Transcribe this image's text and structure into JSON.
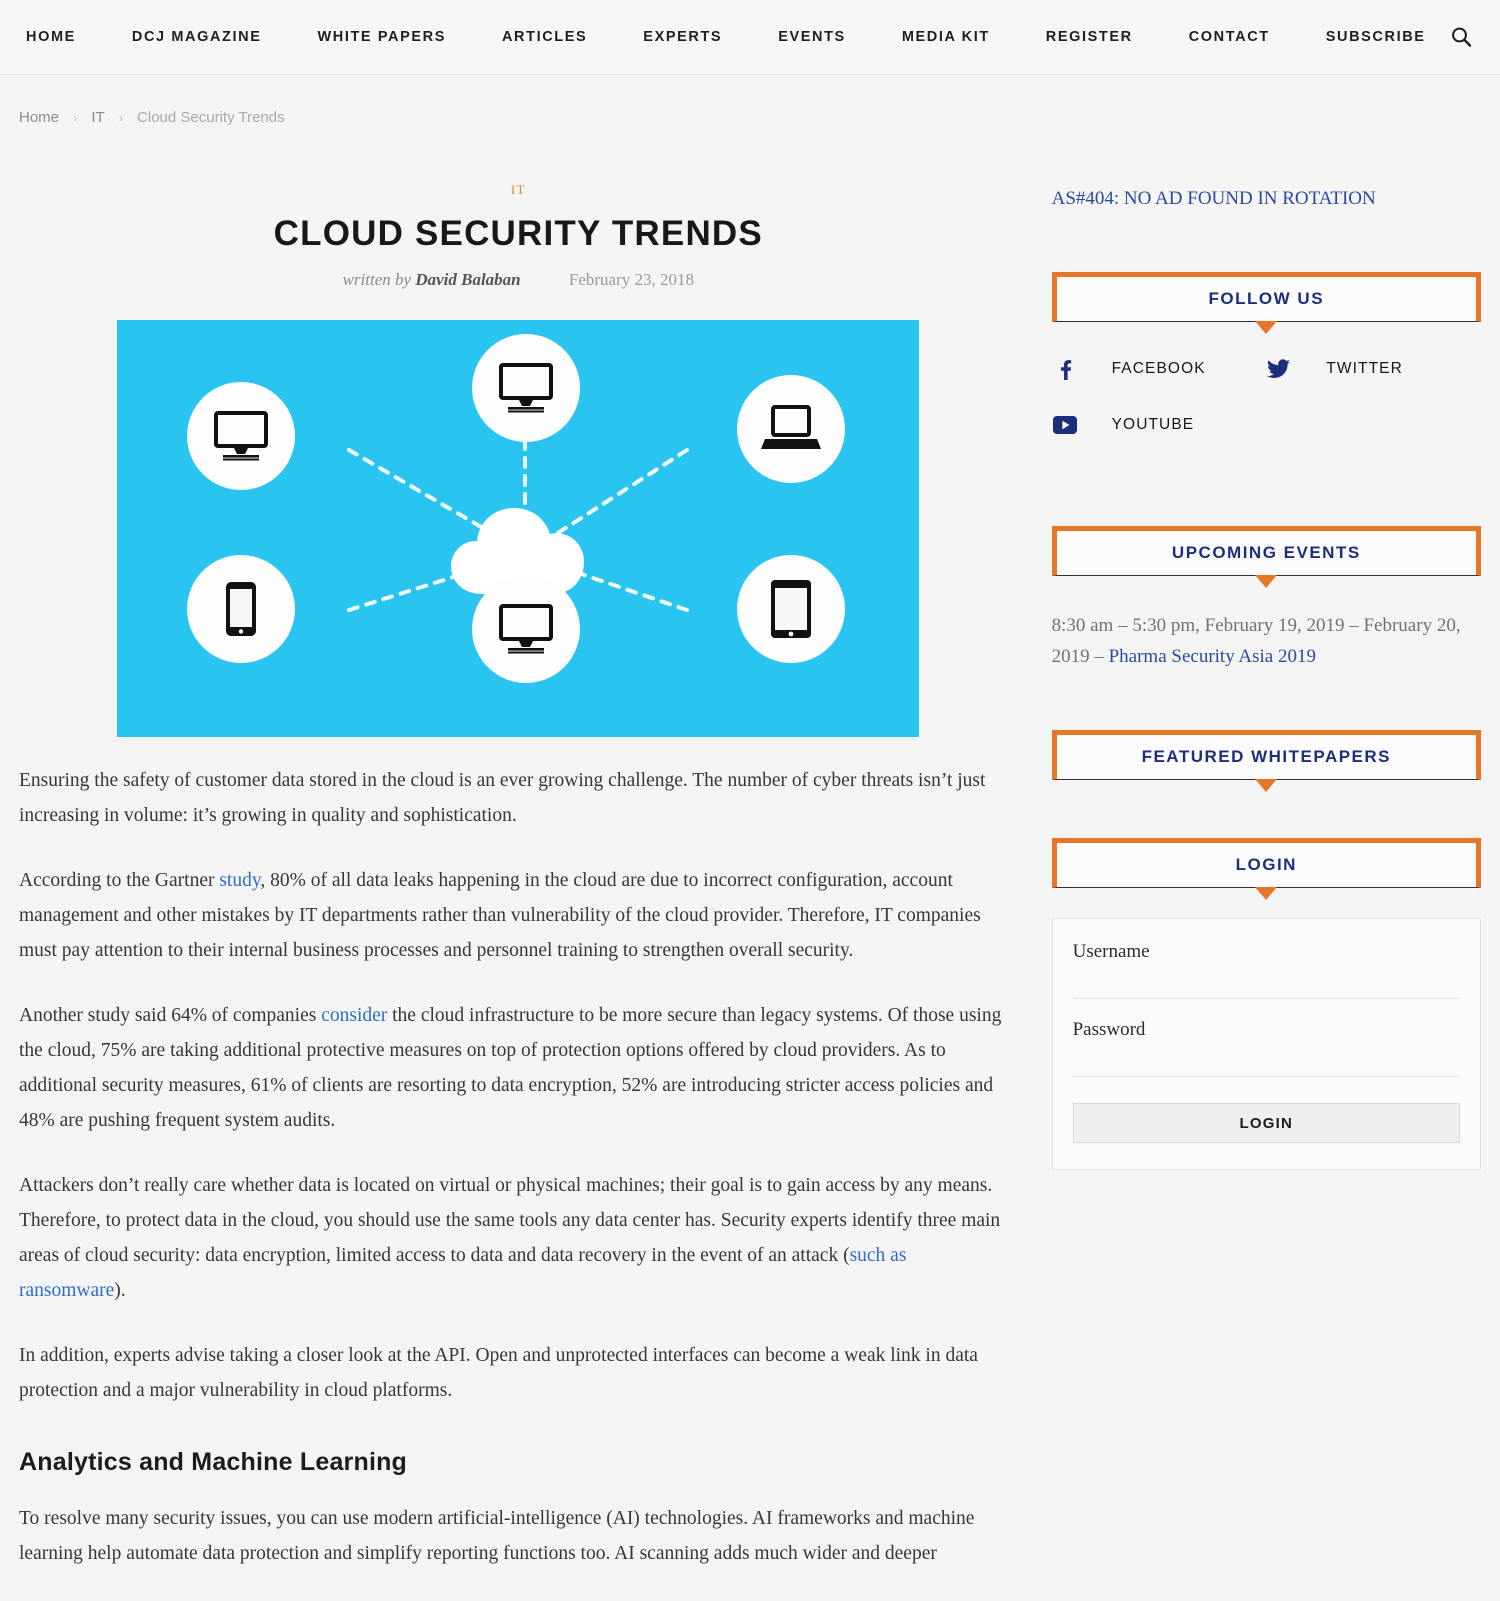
{
  "nav": {
    "items": [
      {
        "label": "HOME"
      },
      {
        "label": "DCJ MAGAZINE"
      },
      {
        "label": "WHITE PAPERS"
      },
      {
        "label": "ARTICLES"
      },
      {
        "label": "EXPERTS"
      },
      {
        "label": "EVENTS"
      },
      {
        "label": "MEDIA KIT"
      },
      {
        "label": "REGISTER"
      },
      {
        "label": "CONTACT"
      },
      {
        "label": "SUBSCRIBE"
      }
    ],
    "search_icon": "search-icon"
  },
  "breadcrumb": {
    "items": [
      {
        "label": "Home"
      },
      {
        "label": "IT"
      },
      {
        "label": "Cloud Security Trends"
      }
    ],
    "separator": "›"
  },
  "article": {
    "category": "IT",
    "title": "CLOUD SECURITY TRENDS",
    "written_by_label": "written by",
    "author": "David Balaban",
    "date": "February 23, 2018",
    "featured_image": {
      "alt": "cloud network diagram",
      "background_color": "#29c5f0",
      "node_icons": [
        "monitor-icon",
        "monitor-icon",
        "laptop-icon",
        "smartphone-icon",
        "tablet-icon",
        "monitor-icon"
      ],
      "center_icon": "cloud-icon"
    },
    "paragraphs": [
      {
        "parts": [
          {
            "t": "Ensuring the safety of customer data stored in the cloud is an ever growing challenge. The number of cyber threats isn’t just increasing in volume: it’s growing in quality and sophistication."
          }
        ]
      },
      {
        "parts": [
          {
            "t": "According to the Gartner "
          },
          {
            "t": "study",
            "link": true
          },
          {
            "t": ", 80% of all data leaks happening in the cloud are due to incorrect configuration, account management and other mistakes by IT departments rather than vulnerability of the cloud provider. Therefore, IT companies must pay attention to their internal business processes and personnel training to strengthen overall security."
          }
        ]
      },
      {
        "parts": [
          {
            "t": "Another study said 64% of companies "
          },
          {
            "t": "consider",
            "link": true
          },
          {
            "t": " the cloud infrastructure to be more secure than legacy systems. Of those using the cloud, 75% are taking additional protective measures on top of protection options offered by cloud providers. As to additional security measures, 61% of clients are resorting to data encryption, 52% are introducing stricter access policies and 48% are pushing frequent system audits."
          }
        ]
      },
      {
        "parts": [
          {
            "t": "Attackers don’t really care whether data is located on virtual or physical machines; their goal is to gain access by any means. Therefore, to protect data in the cloud, you should use the same tools any data center has. Security experts identify three main areas of cloud security: data encryption, limited access to data and data recovery in the event of an attack ("
          },
          {
            "t": "such as ransomware",
            "link": true
          },
          {
            "t": ")."
          }
        ]
      },
      {
        "parts": [
          {
            "t": "In addition, experts advise taking a closer look at the API. Open and unprotected interfaces can become a weak link in data protection and a major vulnerability in cloud platforms."
          }
        ]
      }
    ],
    "subheading": "Analytics and Machine Learning",
    "paragraphs_after": [
      {
        "parts": [
          {
            "t": "To resolve many security issues, you can use modern artificial-intelligence (AI) technologies. AI frameworks and machine learning help automate data protection and simplify reporting functions too. AI scanning adds much wider and deeper"
          }
        ]
      }
    ]
  },
  "sidebar": {
    "ad_notice": "AS#404: NO AD FOUND IN ROTATION",
    "follow": {
      "title": "FOLLOW US",
      "networks": [
        {
          "label": "FACEBOOK",
          "icon": "facebook-icon"
        },
        {
          "label": "TWITTER",
          "icon": "twitter-icon"
        },
        {
          "label": "YOUTUBE",
          "icon": "youtube-icon"
        }
      ]
    },
    "events": {
      "title": "UPCOMING EVENTS",
      "entry_time": "8:30 am – 5:30 pm, February 19, 2019 – February 20, 2019 – ",
      "entry_link": "Pharma Security Asia 2019"
    },
    "whitepapers": {
      "title": "FEATURED WHITEPAPERS"
    },
    "login": {
      "title": "LOGIN",
      "username_label": "Username",
      "username_value": "",
      "password_label": "Password",
      "password_value": "",
      "submit_label": "LOGIN"
    }
  },
  "colors": {
    "accent_orange": "#e4772a",
    "link_blue": "#2e6ecb",
    "widget_title_blue": "#1c2f7a",
    "image_cyan": "#29c5f0",
    "category_orange": "#e08a2e"
  }
}
